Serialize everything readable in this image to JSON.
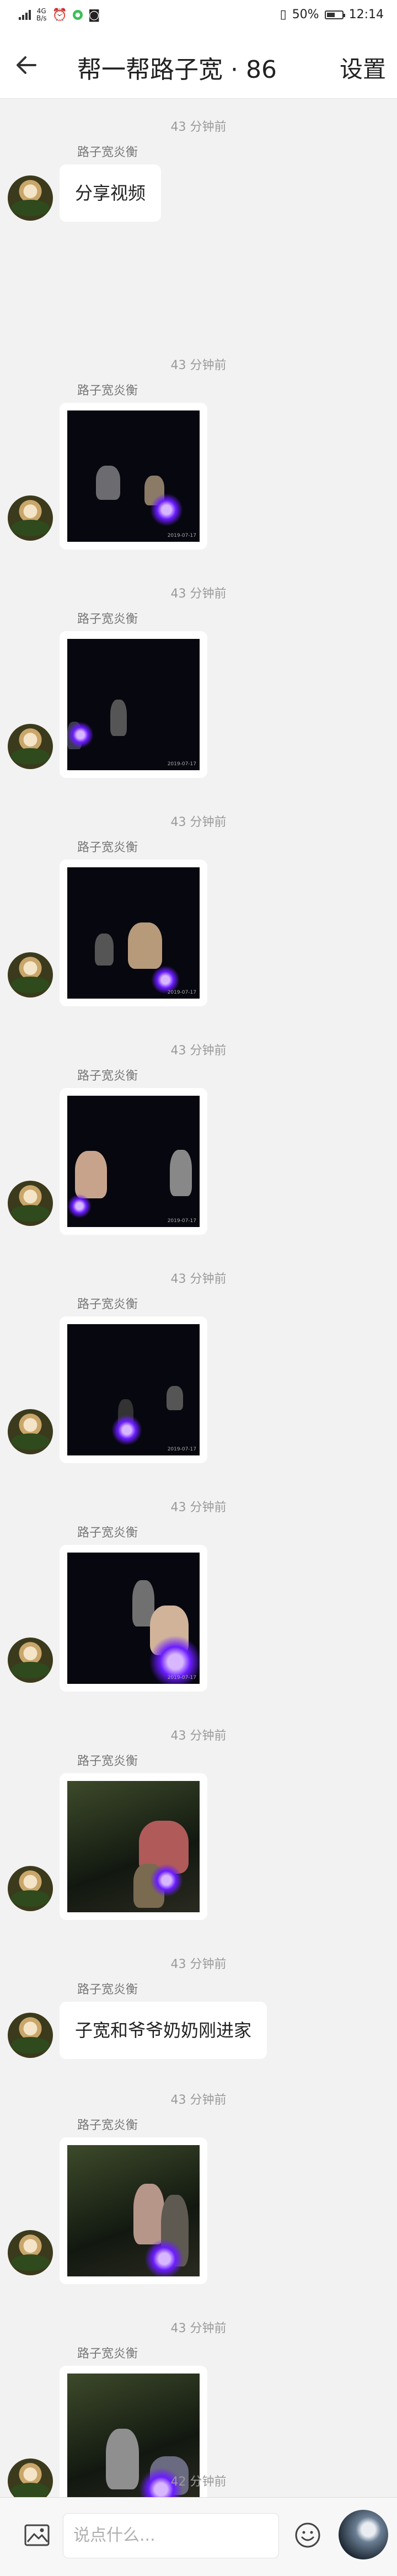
{
  "status_bar": {
    "network_type": "4G",
    "net_speed": "4G\nB/s",
    "alarm_icon": "alarm-icon",
    "battery_pct": "50%",
    "time": "12:14"
  },
  "header": {
    "back_icon": "arrow-left-icon",
    "title": "帮一帮路子宽 · 86",
    "settings_label": "设置"
  },
  "messages": [
    {
      "time": "43 分钟前",
      "sender": "路子宽炎衡",
      "type": "text",
      "text": "分享视频"
    },
    {
      "time": "43 分钟前",
      "sender": "路子宽炎衡",
      "type": "image",
      "photo_stamp": "2019-07-17"
    },
    {
      "time": "43 分钟前",
      "sender": "路子宽炎衡",
      "type": "image",
      "photo_stamp": "2019-07-17"
    },
    {
      "time": "43 分钟前",
      "sender": "路子宽炎衡",
      "type": "image",
      "photo_stamp": "2019-07-17"
    },
    {
      "time": "43 分钟前",
      "sender": "路子宽炎衡",
      "type": "image",
      "photo_stamp": "2019-07-17"
    },
    {
      "time": "43 分钟前",
      "sender": "路子宽炎衡",
      "type": "image",
      "photo_stamp": "2019-07-17"
    },
    {
      "time": "43 分钟前",
      "sender": "路子宽炎衡",
      "type": "image",
      "photo_stamp": "2019-07-17"
    },
    {
      "time": "43 分钟前",
      "sender": "路子宽炎衡",
      "type": "image",
      "photo_stamp": ""
    },
    {
      "time": "43 分钟前",
      "sender": "路子宽炎衡",
      "type": "text",
      "text": "子宽和爷爷奶奶刚进家"
    },
    {
      "time": "43 分钟前",
      "sender": "路子宽炎衡",
      "type": "image",
      "photo_stamp": ""
    },
    {
      "time": "43 分钟前",
      "sender": "路子宽炎衡",
      "type": "image",
      "photo_stamp": ""
    },
    {
      "time": "42 分钟前",
      "sender": "路子宽炎衡",
      "type": "text",
      "text": ""
    }
  ],
  "input_bar": {
    "image_icon": "image-icon",
    "placeholder": "说点什么...",
    "emoji_icon": "emoji-icon"
  }
}
